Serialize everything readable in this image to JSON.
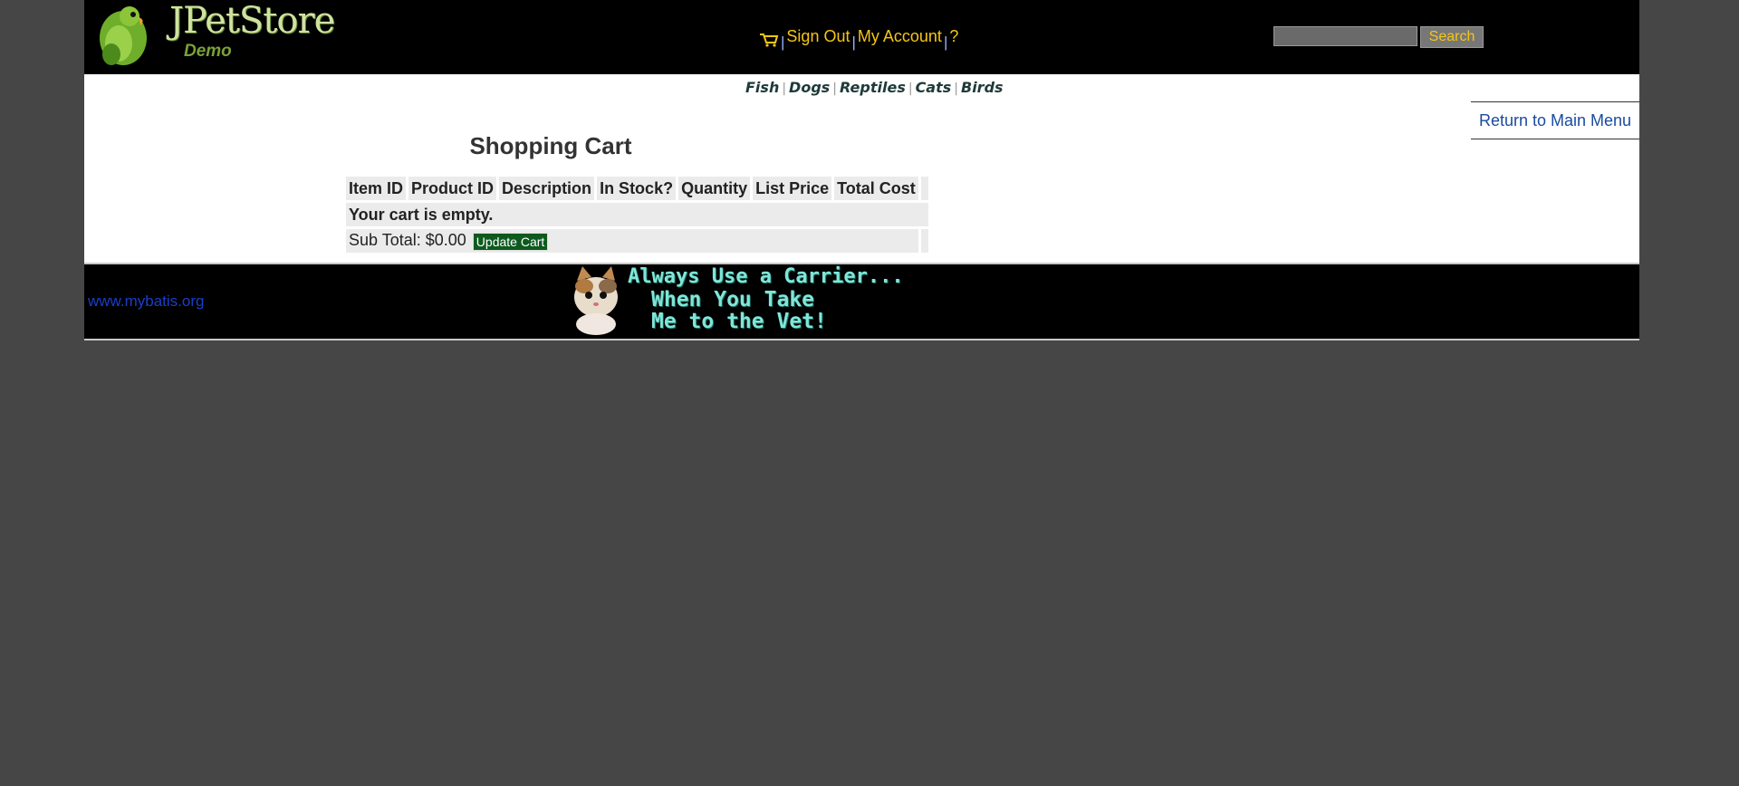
{
  "header": {
    "logo_title": "JPetStore",
    "logo_subtitle": "Demo",
    "menu": {
      "cart_icon": "shopping-cart-icon",
      "sign_out": "Sign Out",
      "separator": "|",
      "my_account": "My Account",
      "help": "?"
    },
    "search": {
      "value": "",
      "button_label": "Search"
    }
  },
  "quicklinks": [
    "Fish",
    "Dogs",
    "Reptiles",
    "Cats",
    "Birds"
  ],
  "back_link": "Return to Main Menu",
  "cart": {
    "title": "Shopping Cart",
    "columns": [
      "Item ID",
      "Product ID",
      "Description",
      "In Stock?",
      "Quantity",
      "List Price",
      "Total Cost"
    ],
    "empty_message": "Your cart is empty.",
    "subtotal": "Sub Total: $0.00",
    "update_button": "Update Cart"
  },
  "footer": {
    "link": "www.mybatis.org",
    "banner_lines": [
      "Always Use a Carrier...",
      "When You Take",
      "Me to the Vet!"
    ]
  },
  "colors": {
    "header_bg": "#000000",
    "menu_link": "#f5c518",
    "update_button_bg": "#0e5a1e",
    "link_blue": "#1a4ba0",
    "page_bg": "#464646"
  }
}
